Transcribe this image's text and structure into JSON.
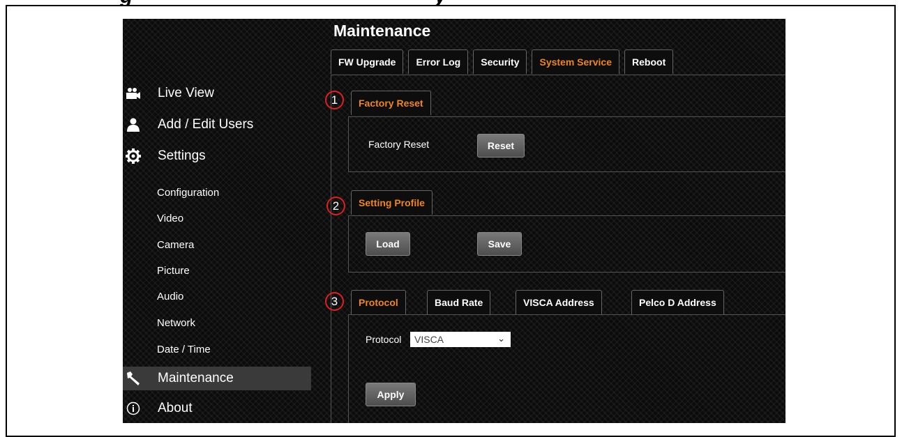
{
  "header": {
    "title_left": "g",
    "title_right": "y"
  },
  "sidebar": {
    "main_items": [
      {
        "label": "Live View",
        "icon": "camera-users-icon"
      },
      {
        "label": "Add / Edit Users",
        "icon": "user-icon"
      },
      {
        "label": "Settings",
        "icon": "gear-icon"
      }
    ],
    "sub_items": [
      "Configuration",
      "Video",
      "Camera",
      "Picture",
      "Audio",
      "Network",
      "Date / Time"
    ],
    "maintenance": {
      "label": "Maintenance",
      "icon": "wrench-icon",
      "active": true
    },
    "about": {
      "label": "About",
      "icon": "info-icon"
    }
  },
  "main": {
    "title": "Maintenance",
    "tabs": [
      {
        "label": "FW Upgrade",
        "active": false
      },
      {
        "label": "Error Log",
        "active": false
      },
      {
        "label": "Security",
        "active": false
      },
      {
        "label": "System Service",
        "active": true
      },
      {
        "label": "Reboot",
        "active": false
      }
    ],
    "factory_reset": {
      "marker": "1",
      "tab_label": "Factory Reset",
      "field_label": "Factory Reset",
      "button_label": "Reset"
    },
    "setting_profile": {
      "marker": "2",
      "tab_label": "Setting Profile",
      "load_label": "Load",
      "save_label": "Save"
    },
    "protocol_section": {
      "marker": "3",
      "tabs": [
        {
          "label": "Protocol",
          "active": true
        },
        {
          "label": "Baud Rate",
          "active": false
        },
        {
          "label": "VISCA Address",
          "active": false
        },
        {
          "label": "Pelco D Address",
          "active": false
        }
      ],
      "field_label": "Protocol",
      "select_value": "VISCA",
      "apply_label": "Apply"
    }
  },
  "colors": {
    "accent": "#f0861e",
    "marker": "#e02020",
    "background": "#0b0b0b"
  }
}
